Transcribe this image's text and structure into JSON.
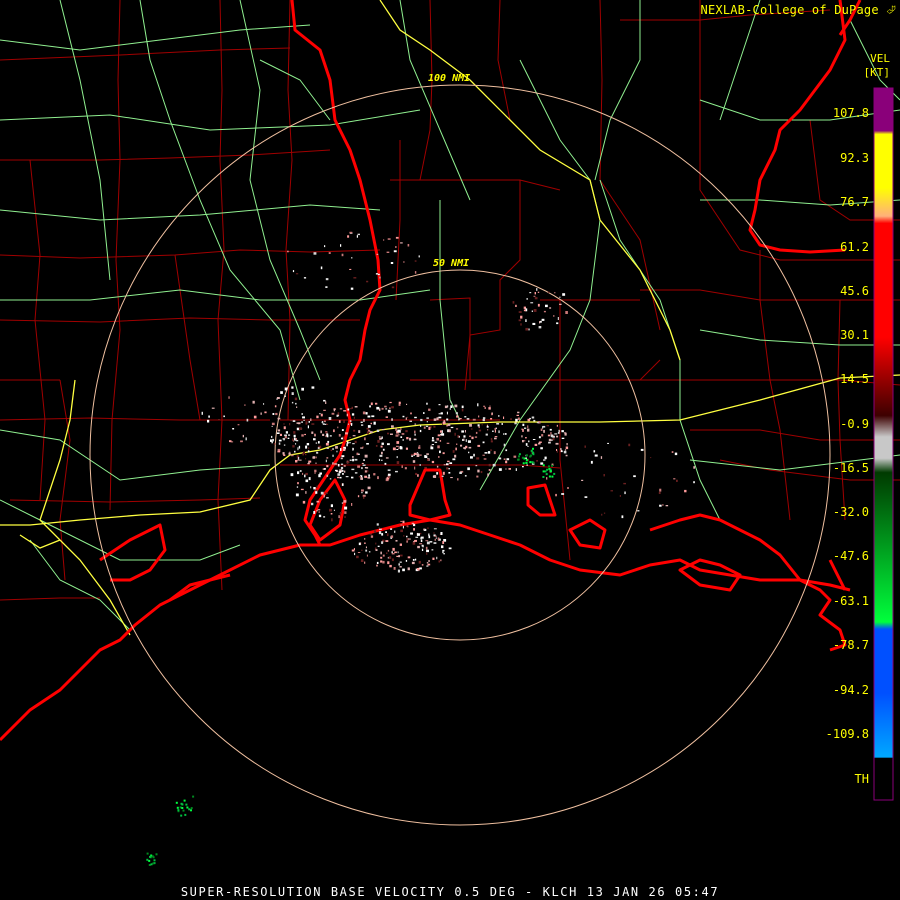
{
  "map": {
    "credit": "NEXLAB-College of DuPage",
    "credit_icon": "logo-icon",
    "caption": "SUPER-RESOLUTION BASE VELOCITY 0.5 DEG - KLCH 13 JAN 26 05:47",
    "range_rings": [
      "100 NMI",
      "50 NMI"
    ]
  },
  "legend": {
    "product": "VEL",
    "unit": "[KT]",
    "labels": [
      "107.8",
      "92.3",
      "76.7",
      "61.2",
      "45.6",
      "30.1",
      "14.5",
      "-0.9",
      "-16.5",
      "-32.0",
      "-47.6",
      "-63.1",
      "-78.7",
      "-94.2",
      "-109.8",
      "TH"
    ],
    "colors": {
      "purple": "#8a007a",
      "yellow": "#ffff00",
      "peach": "#ffb07a",
      "red": "#ff0000",
      "dark_red": "#3d0000",
      "gray": "#c8c8c8",
      "dark_green": "#003a00",
      "green": "#00ff3c",
      "blue": "#0050ff",
      "light_blue": "#00a8ff"
    }
  },
  "style": {
    "coastline_color": "#ff0000",
    "county_color": "#a00000",
    "highway_color": "#90f090",
    "interstate_color": "#ffff40",
    "ring_color": "#f0c0a0"
  }
}
